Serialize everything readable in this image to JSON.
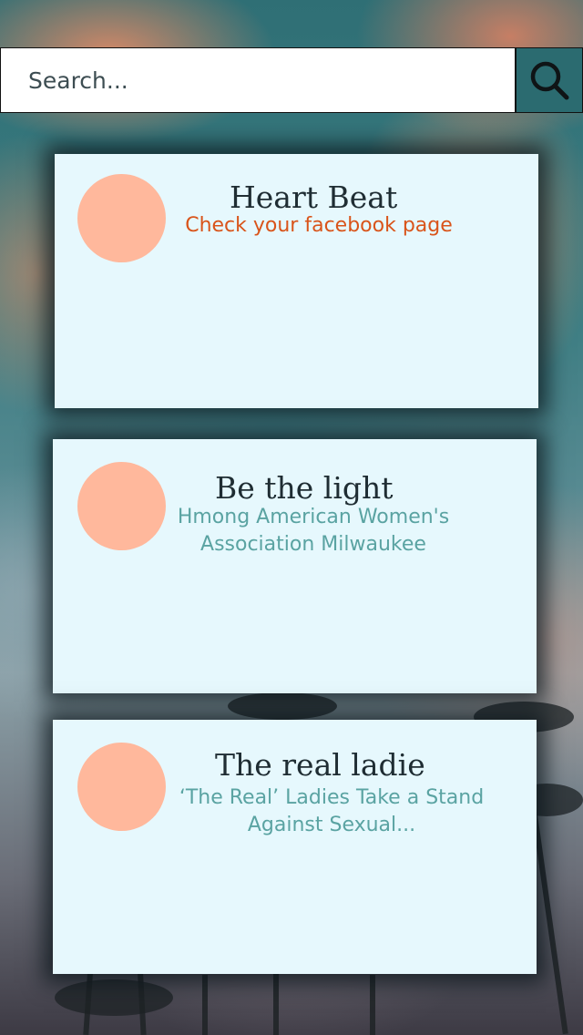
{
  "search": {
    "placeholder": "Search..."
  },
  "icons": {
    "search_button": "search-icon"
  },
  "colors": {
    "card_background": "#e6f8fd",
    "avatar": "#ffb89c",
    "search_button": "#2b6b70",
    "title": "#1f2d33",
    "subtitle_orange": "#d9541a",
    "subtitle_teal": "#5aa3a2"
  },
  "cards": [
    {
      "title": "Heart Beat",
      "subtitle_line1": "Check your facebook page",
      "subtitle_line2": ""
    },
    {
      "title": "Be the light",
      "subtitle_line1": "Hmong American Women's",
      "subtitle_line2": "Association Milwaukee"
    },
    {
      "title": "The real ladie",
      "subtitle_line1": "‘The Real’ Ladies Take a Stand",
      "subtitle_line2": "Against Sexual..."
    }
  ]
}
